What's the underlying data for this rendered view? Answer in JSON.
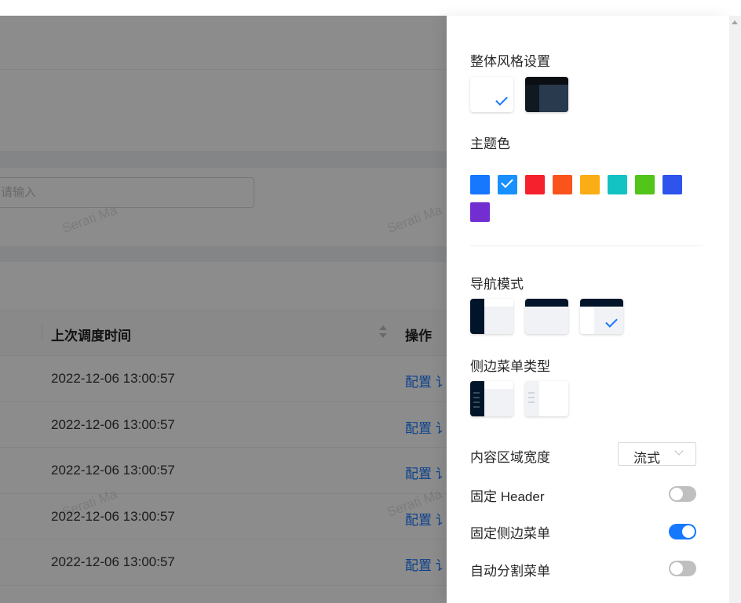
{
  "background_page": {
    "search_placeholder": "请输入",
    "table": {
      "columns": {
        "last_schedule_time": "上次调度时间",
        "actions": "操作"
      },
      "rows": [
        {
          "time": "2022-12-06 13:00:57",
          "action": "配置 讠"
        },
        {
          "time": "2022-12-06 13:00:57",
          "action": "配置 讠"
        },
        {
          "time": "2022-12-06 13:00:57",
          "action": "配置 讠"
        },
        {
          "time": "2022-12-06 13:00:57",
          "action": "配置 讠"
        },
        {
          "time": "2022-12-06 13:00:57",
          "action": "配置 讠"
        }
      ]
    },
    "watermarks": [
      "Serati Ma",
      "Serati Ma",
      "Serati Ma",
      "Serati Ma"
    ]
  },
  "settings_drawer": {
    "overall_style_title": "整体风格设置",
    "theme_color_title": "主题色",
    "theme_colors": [
      "#1677ff",
      "#1890ff",
      "#f5222d",
      "#fa541c",
      "#faad14",
      "#13c2c2",
      "#52c41a",
      "#2f54eb",
      "#722ed1"
    ],
    "selected_theme_color_index": 1,
    "nav_mode_title": "导航模式",
    "side_menu_type_title": "侧边菜单类型",
    "content_width_label": "内容区域宽度",
    "content_width_value": "流式",
    "fixed_header_label": "固定 Header",
    "fixed_header_on": false,
    "fixed_side_menu_label": "固定侧边菜单",
    "fixed_side_menu_on": true,
    "auto_split_menu_label": "自动分割菜单",
    "auto_split_menu_on": false
  }
}
